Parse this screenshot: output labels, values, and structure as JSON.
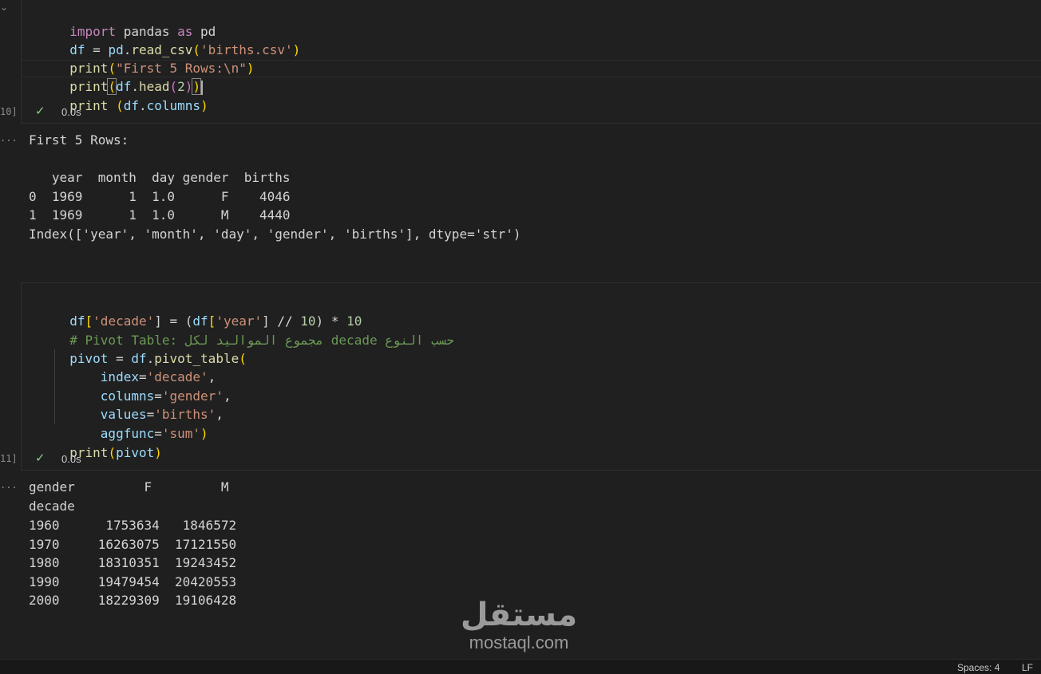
{
  "cell1": {
    "exec_count": "10]",
    "chevron": "⌄",
    "exec_time": "0.0s",
    "code": [
      [
        "import",
        " pandas ",
        "as",
        " pd"
      ],
      [
        "df",
        " = ",
        "pd",
        ".",
        "read_csv",
        "(",
        "'births.csv'",
        ")"
      ],
      [
        "print",
        "(",
        "\"First 5 Rows:\\n\"",
        ")"
      ],
      [
        "print",
        "(",
        "df",
        ".",
        "head",
        "(",
        "2",
        ")",
        ")"
      ],
      [
        "print",
        " ",
        "(",
        "df",
        ".",
        "columns",
        ")"
      ]
    ],
    "output_marker": "...",
    "output": [
      "First 5 Rows:",
      "",
      "   year  month  day gender  births",
      "0  1969      1  1.0      F    4046",
      "1  1969      1  1.0      M    4440",
      "Index(['year', 'month', 'day', 'gender', 'births'], dtype='str')"
    ]
  },
  "cell2": {
    "exec_count": "11]",
    "exec_time": "0.0s",
    "code": [
      [
        "df",
        "[",
        "'decade'",
        "] = (",
        "df",
        "[",
        "'year'",
        "] // ",
        "10",
        ") * ",
        "10"
      ],
      [
        "# Pivot Table: مجموع المواليد لكل decade حسب النوع"
      ],
      [
        "pivot",
        " = ",
        "df",
        ".",
        "pivot_table",
        "("
      ],
      [
        "    ",
        "index",
        "=",
        "'decade'",
        ","
      ],
      [
        "    ",
        "columns",
        "=",
        "'gender'",
        ","
      ],
      [
        "    ",
        "values",
        "=",
        "'births'",
        ","
      ],
      [
        "    ",
        "aggfunc",
        "=",
        "'sum'",
        ")"
      ],
      [
        "print",
        "(",
        "pivot",
        ")"
      ]
    ],
    "output_marker": "...",
    "output": [
      "gender         F         M",
      "decade",
      "1960      1753634   1846572",
      "1970     16263075  17121550",
      "1980     18310351  19243452",
      "1990     19479454  20420553",
      "2000     18229309  19106428"
    ]
  },
  "watermark": {
    "arabic": "مستقل",
    "latin": "mostaql.com"
  },
  "statusbar": {
    "spaces": "Spaces: 4",
    "eol": "LF"
  },
  "colors": {
    "check": "#89d185",
    "keyword": "#c586c0",
    "string": "#ce9178",
    "function": "#dcdcaa",
    "variable": "#9cdcfe",
    "comment": "#6a9955"
  }
}
